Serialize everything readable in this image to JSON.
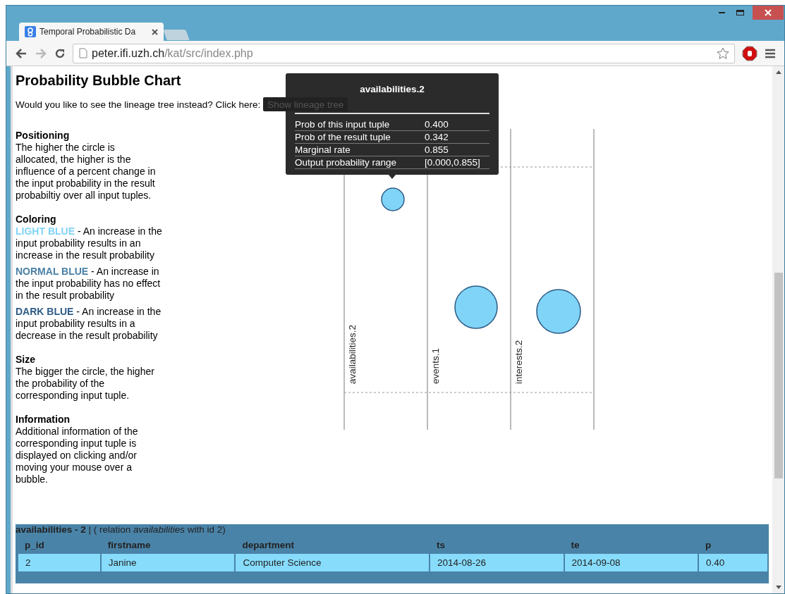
{
  "browser": {
    "tab": {
      "title": "Temporal Probabilistic Da",
      "selected": true
    },
    "address": {
      "host": "peter.ifi.uzh.ch",
      "path": "/kat/src/index.php"
    }
  },
  "page": {
    "heading": "Probability Bubble Chart",
    "prompt": "Would you like to see the lineage tree instead? Click here:",
    "lineage_button": "Show lineage tree",
    "sections": [
      {
        "title": "Positioning",
        "text": "The higher the circle is allocated, the higher is the influence of a percent change in the input probability in the result probabiltiy over all input tuples."
      },
      {
        "title": "Coloring",
        "items": [
          {
            "term": "LIGHT BLUE",
            "color": "#80d4f8",
            "text": " - An increase in the input probability results in an increase in the result probability"
          },
          {
            "term": "NORMAL BLUE",
            "color": "#4a7fa6",
            "text": " - An increase in the input probability has no effect in the result probability"
          },
          {
            "term": "DARK BLUE",
            "color": "#2d5c86",
            "text": " - An increase in the input probability results in a decrease in the result probability"
          }
        ]
      },
      {
        "title": "Size",
        "text": "The bigger the circle, the higher the probability of the corresponding input tuple."
      },
      {
        "title": "Information",
        "text": "Additional information of the corresponding input tuple is displayed on clicking and/or moving your mouse over a bubble."
      }
    ]
  },
  "chart": {
    "columns": [
      {
        "label": "availabilities.2"
      },
      {
        "label": "events.1"
      },
      {
        "label": "interests.2"
      }
    ]
  },
  "tooltip": {
    "title": "availabilities.2",
    "rows": [
      {
        "label": "Prob of this input tuple",
        "value": "0.400"
      },
      {
        "label": "Prob of the result tuple",
        "value": "0.342"
      },
      {
        "label": "Marginal rate",
        "value": "0.855"
      },
      {
        "label": "Output probability range",
        "value": "[0.000,0.855]"
      }
    ]
  },
  "detail": {
    "caption": "**availabilities - 2** | ( relation *availabilities* with id 2)",
    "columns": [
      "p_id",
      "firstname",
      "department",
      "ts",
      "te",
      "p"
    ],
    "rows": [
      [
        "2",
        "Janine",
        "Computer Science",
        "2014-08-26",
        "2014-09-08",
        "0.40"
      ]
    ]
  }
}
